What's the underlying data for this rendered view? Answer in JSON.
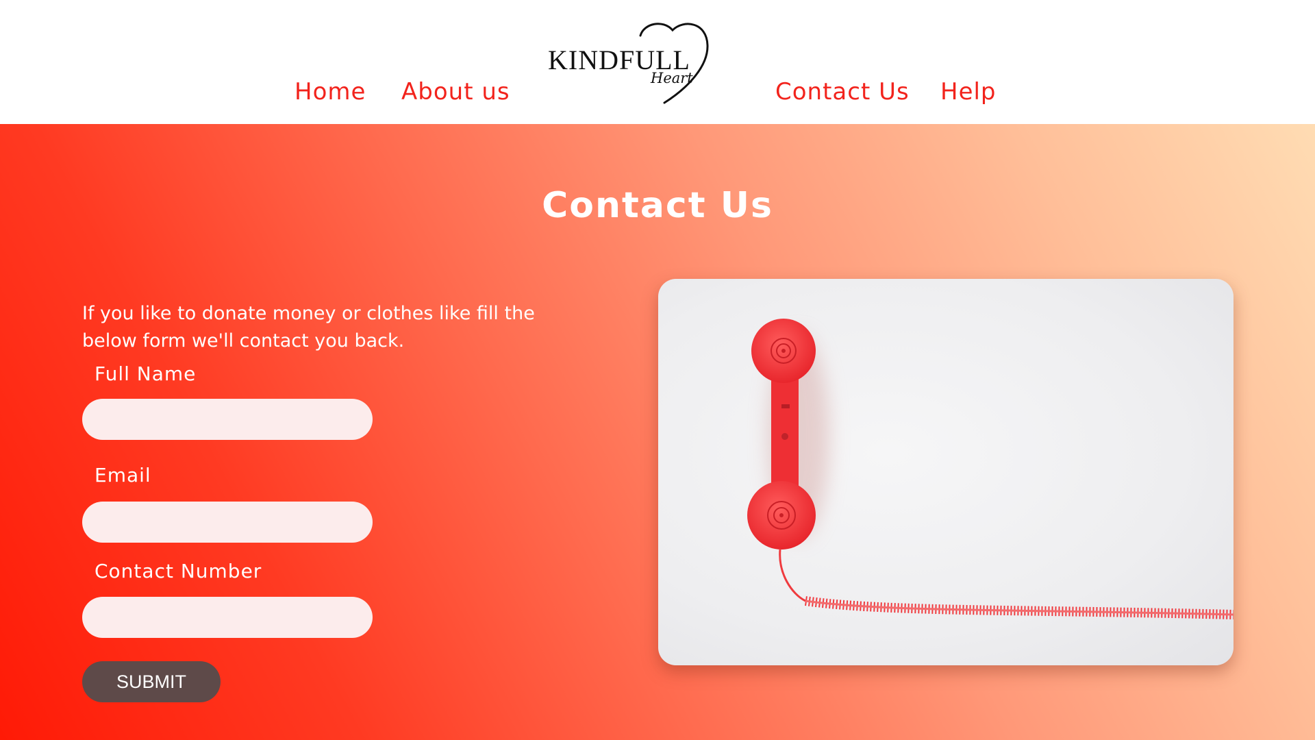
{
  "brand": {
    "name": "KINDFULL",
    "tagline": "Heart"
  },
  "nav": {
    "home": "Home",
    "about": "About us",
    "contact": "Contact Us",
    "help": "Help"
  },
  "hero": {
    "title": "Contact Us",
    "intro": "If you like to donate money or clothes like fill the below form we'll contact you back."
  },
  "form": {
    "full_name_label": "Full Name",
    "full_name_value": "",
    "email_label": "Email",
    "email_value": "",
    "contact_number_label": "Contact Number",
    "contact_number_value": "",
    "submit_label": "SUBMIT"
  },
  "colors": {
    "accent": "#f2231c",
    "button": "#5e4a49",
    "input_bg": "#fcecec"
  },
  "icons": {
    "logo": "heart-icon",
    "photo": "telephone-handset-photo"
  }
}
